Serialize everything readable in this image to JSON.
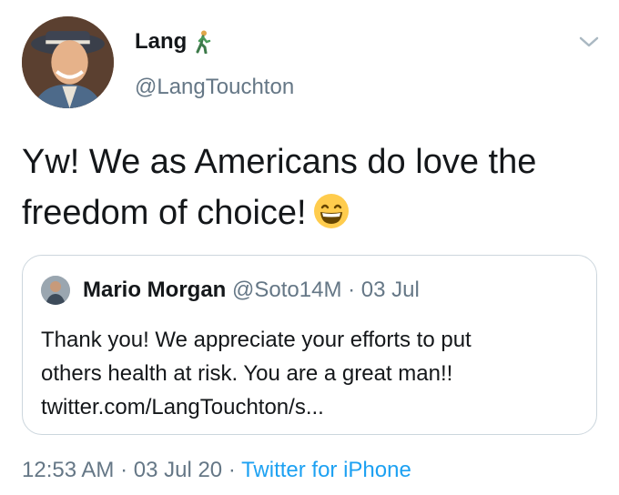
{
  "author": {
    "display_name": "Lang",
    "name_emoji_icon": "person-walking-icon",
    "handle": "@LangTouchton"
  },
  "tweet": {
    "text": "Yw! We as Americans do love the freedom of choice!",
    "emoji_icon": "grinning-face-with-smiling-eyes-icon"
  },
  "quoted_tweet": {
    "display_name": "Mario Morgan",
    "handle": "@Soto14M",
    "separator": "·",
    "date": "03 Jul",
    "text_line1": "Thank you! We appreciate your efforts to put",
    "text_line2": "others health at risk. You are a great man!!",
    "link": "twitter.com/LangTouchton/s..."
  },
  "footer": {
    "time": "12:53 AM",
    "sep1": "·",
    "date": "03 Jul 20",
    "sep2": "·",
    "source": "Twitter for iPhone"
  },
  "colors": {
    "text": "#14171a",
    "secondary": "#657786",
    "link": "#1da1f2",
    "border": "#ccd6dd"
  }
}
